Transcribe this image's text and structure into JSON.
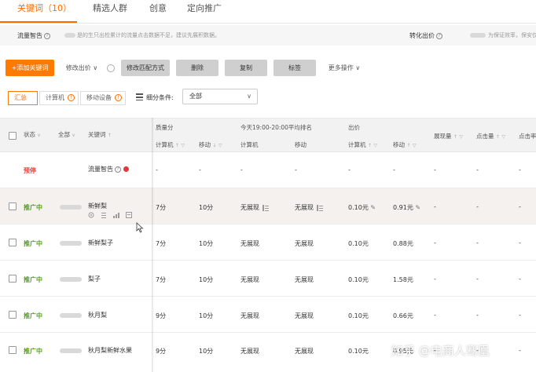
{
  "tabs": [
    {
      "label": "关键词（10）",
      "active": true
    },
    {
      "label": "精选人群",
      "active": false
    },
    {
      "label": "创意",
      "active": false
    },
    {
      "label": "定向推广",
      "active": false
    }
  ],
  "warning_bar": {
    "label": "流量智告",
    "desc_visible": "是的生只出检累计的流量点击数据不足，建议先展积数据。",
    "conversion_label": "转化出价",
    "conversion_desc": "为保证效率，保安仅回"
  },
  "toolbar": {
    "add_keyword": "+添加关键词",
    "modify_bid": "修改出价",
    "modify_match": "修改匹配方式",
    "delete": "删除",
    "copy": "复制",
    "tag": "标签",
    "more": "更多操作"
  },
  "filters": {
    "segments": [
      "汇总",
      "计算机",
      "移动设备"
    ],
    "subdivide_label": "细分条件:",
    "subdivide_value": "全部"
  },
  "table": {
    "headers": {
      "status": "状态",
      "all": "全部",
      "keyword": "关键词",
      "quality": "质量分",
      "quality_pc": "计算机",
      "quality_mobile": "移动",
      "rank_group": "今天19:00-20:00平均排名",
      "rank_pc": "计算机",
      "rank_mobile": "移动",
      "bid": "出价",
      "bid_pc": "计算机",
      "bid_mobile": "移动",
      "impressions": "展现量",
      "clicks": "点击量",
      "ctr": "点击率"
    },
    "rows": [
      {
        "status": "预停",
        "status_type": "off",
        "keyword": "流量智告",
        "quality_pc": "-",
        "quality_mobile": "-",
        "rank_pc": "-",
        "rank_mobile": "-",
        "bid_pc": "-",
        "bid_mobile": "-",
        "impressions": "-",
        "clicks": "-",
        "ctr": "-"
      },
      {
        "status": "推广中",
        "status_type": "on",
        "keyword": "新鲜梨",
        "quality_pc": "7分",
        "quality_mobile": "10分",
        "rank_pc": "无展现",
        "rank_mobile": "无展现",
        "bid_pc": "0.10元",
        "bid_mobile": "0.91元",
        "impressions": "-",
        "clicks": "-",
        "ctr": "-"
      },
      {
        "status": "推广中",
        "status_type": "on",
        "keyword": "新鲜梨子",
        "quality_pc": "7分",
        "quality_mobile": "10分",
        "rank_pc": "无展现",
        "rank_mobile": "无展现",
        "bid_pc": "0.10元",
        "bid_mobile": "0.88元",
        "impressions": "-",
        "clicks": "-",
        "ctr": "-"
      },
      {
        "status": "推广中",
        "status_type": "on",
        "keyword": "梨子",
        "quality_pc": "7分",
        "quality_mobile": "10分",
        "rank_pc": "无展现",
        "rank_mobile": "无展现",
        "bid_pc": "0.10元",
        "bid_mobile": "1.58元",
        "impressions": "-",
        "clicks": "-",
        "ctr": "-"
      },
      {
        "status": "推广中",
        "status_type": "on",
        "keyword": "秋月梨",
        "quality_pc": "9分",
        "quality_mobile": "10分",
        "rank_pc": "无展现",
        "rank_mobile": "无展现",
        "bid_pc": "0.10元",
        "bid_mobile": "0.66元",
        "impressions": "-",
        "clicks": "-",
        "ctr": "-"
      },
      {
        "status": "推广中",
        "status_type": "on",
        "keyword": "秋月梨新鲜水果",
        "quality_pc": "9分",
        "quality_mobile": "10分",
        "rank_pc": "无展现",
        "rank_mobile": "无展现",
        "bid_pc": "0.10元",
        "bid_mobile": "0.95元",
        "impressions": "-",
        "clicks": "-",
        "ctr": "-"
      }
    ]
  },
  "watermark": "知乎 @电商人骞凰",
  "colors": {
    "accent": "#ff6a00",
    "status_on": "#52a315",
    "status_off": "#e8443c"
  },
  "icons": [
    "help-icon",
    "warning-icon",
    "chevron-down-icon",
    "grid-icon",
    "edit-icon",
    "filter-icon",
    "sort-icon",
    "checkbox-icon",
    "red-dot-icon",
    "mouse-cursor-icon"
  ]
}
